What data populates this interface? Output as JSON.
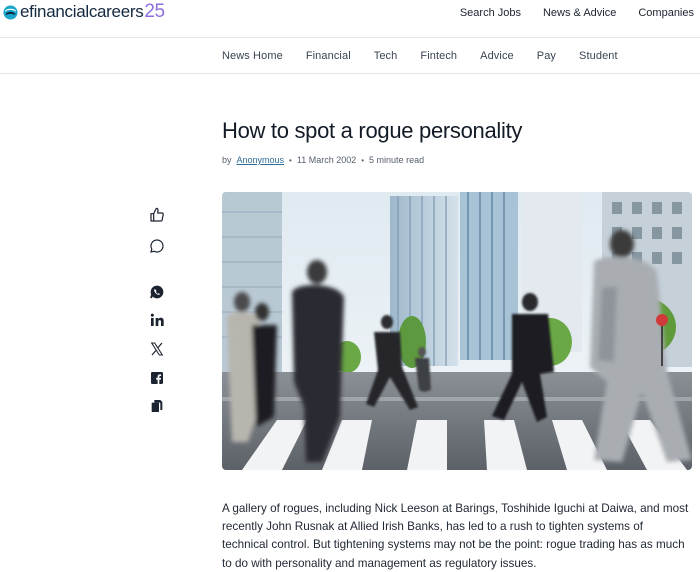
{
  "brand": {
    "name": "efinancialcareers",
    "number": "25",
    "accent": "#8f6ee0",
    "mark_color": "#1aa6c9"
  },
  "top_nav": [
    {
      "label": "Search Jobs"
    },
    {
      "label": "News & Advice"
    },
    {
      "label": "Companies"
    }
  ],
  "sub_nav": [
    {
      "label": "News Home"
    },
    {
      "label": "Financial"
    },
    {
      "label": "Tech"
    },
    {
      "label": "Fintech"
    },
    {
      "label": "Advice"
    },
    {
      "label": "Pay"
    },
    {
      "label": "Student"
    }
  ],
  "article": {
    "title": "How to spot a rogue personality",
    "by_prefix": "by",
    "author": "Anonymous",
    "date": "11 March 2002",
    "read_time": "5 minute read",
    "separator": "•",
    "lead": "A gallery of rogues, including Nick Leeson at Barings, Toshihide Iguchi at Daiwa, and most recently John Rusnak at Allied Irish Banks, has led to a rush to tighten systems of technical control. But tightening systems may not be the point: rogue trading has as much to do with personality and management as regulatory issues."
  },
  "share_rail": [
    {
      "icon": "thumbs-up-icon"
    },
    {
      "icon": "comment-icon"
    },
    {
      "icon": "whatsapp-icon"
    },
    {
      "icon": "linkedin-icon"
    },
    {
      "icon": "x-icon"
    },
    {
      "icon": "facebook-icon"
    },
    {
      "icon": "copy-icon"
    }
  ],
  "hero_image": {
    "subject": "commuters-crossing-street-photo"
  }
}
